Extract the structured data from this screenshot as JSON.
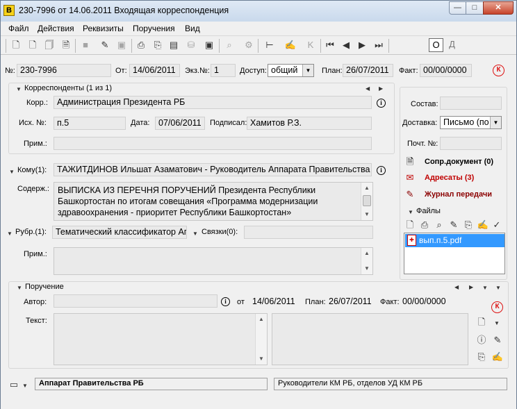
{
  "window": {
    "title": "230-7996 от 14.06.2011 Входящая корреспонденция",
    "app_icon": "B",
    "controls": {
      "minimize": "—",
      "maximize": "□",
      "close": "✕"
    }
  },
  "menu": [
    "Файл",
    "Действия",
    "Реквизиты",
    "Поручения",
    "Вид"
  ],
  "toolbar": {
    "toggles": [
      "О",
      "Д"
    ]
  },
  "header": {
    "number_label": "№:",
    "number": "230-7996",
    "from_label": "От:",
    "from_date": "14/06/2011",
    "copy_label": "Экз.№:",
    "copy": "1",
    "access_label": "Доступ:",
    "access": "общий",
    "plan_label": "План:",
    "plan": "26/07/2011",
    "fact_label": "Факт:",
    "fact": "00/00/0000",
    "k_button": "К"
  },
  "correspondents": {
    "title": "Корреспонденты (1 из 1)",
    "corr_label": "Корр.:",
    "corr": "Администрация Президента РБ",
    "out_no_label": "Исх. №:",
    "out_no": "п.5",
    "date_label": "Дата:",
    "date": "07/06/2011",
    "signed_label": "Подписал:",
    "signed": "Хамитов Р.З.",
    "note_label": "Прим.:",
    "note": ""
  },
  "right_panel": {
    "composition_label": "Состав:",
    "composition": "",
    "delivery_label": "Доставка:",
    "delivery": "Письмо (по",
    "mail_no_label": "Почт. №:",
    "mail_no": "",
    "links": [
      "Сопр.документ (0)",
      "Адресаты (3)",
      "Журнал передачи"
    ],
    "link_colors": [
      "#000000",
      "#c00000",
      "#8b0000"
    ],
    "files_title": "Файлы",
    "files": [
      "вып.п.5.pdf"
    ]
  },
  "addressee": {
    "to_label": "Кому(1):",
    "to": "ТАЖИТДИНОВ Ильшат Азаматович - Руководитель Аппарата Правительства",
    "content_label": "Содерж.:",
    "content_lines": [
      "ВЫПИСКА ИЗ ПЕРЕЧНЯ ПОРУЧЕНИЙ Президента Республики",
      "Башкортостан по итогам совещания «Программа модернизации",
      "здравоохранения - приоритет Республики Башкортостан»"
    ],
    "rubric_label": "Рубр.(1):",
    "rubric": "Тематический классификатор Аг",
    "links_label": "Связки(0):",
    "note_label": "Прим.:"
  },
  "order": {
    "title": "Поручение",
    "author_label": "Автор:",
    "author": "",
    "from_label": "от",
    "from_date": "14/06/2011",
    "plan_label": "План:",
    "plan": "26/07/2011",
    "fact_label": "Факт:",
    "fact": "00/00/0000",
    "text_label": "Текст:",
    "k_button": "К"
  },
  "status": {
    "left": "Аппарат Правительства РБ",
    "right": "Руководители КМ РБ, отделов УД КМ РБ"
  }
}
